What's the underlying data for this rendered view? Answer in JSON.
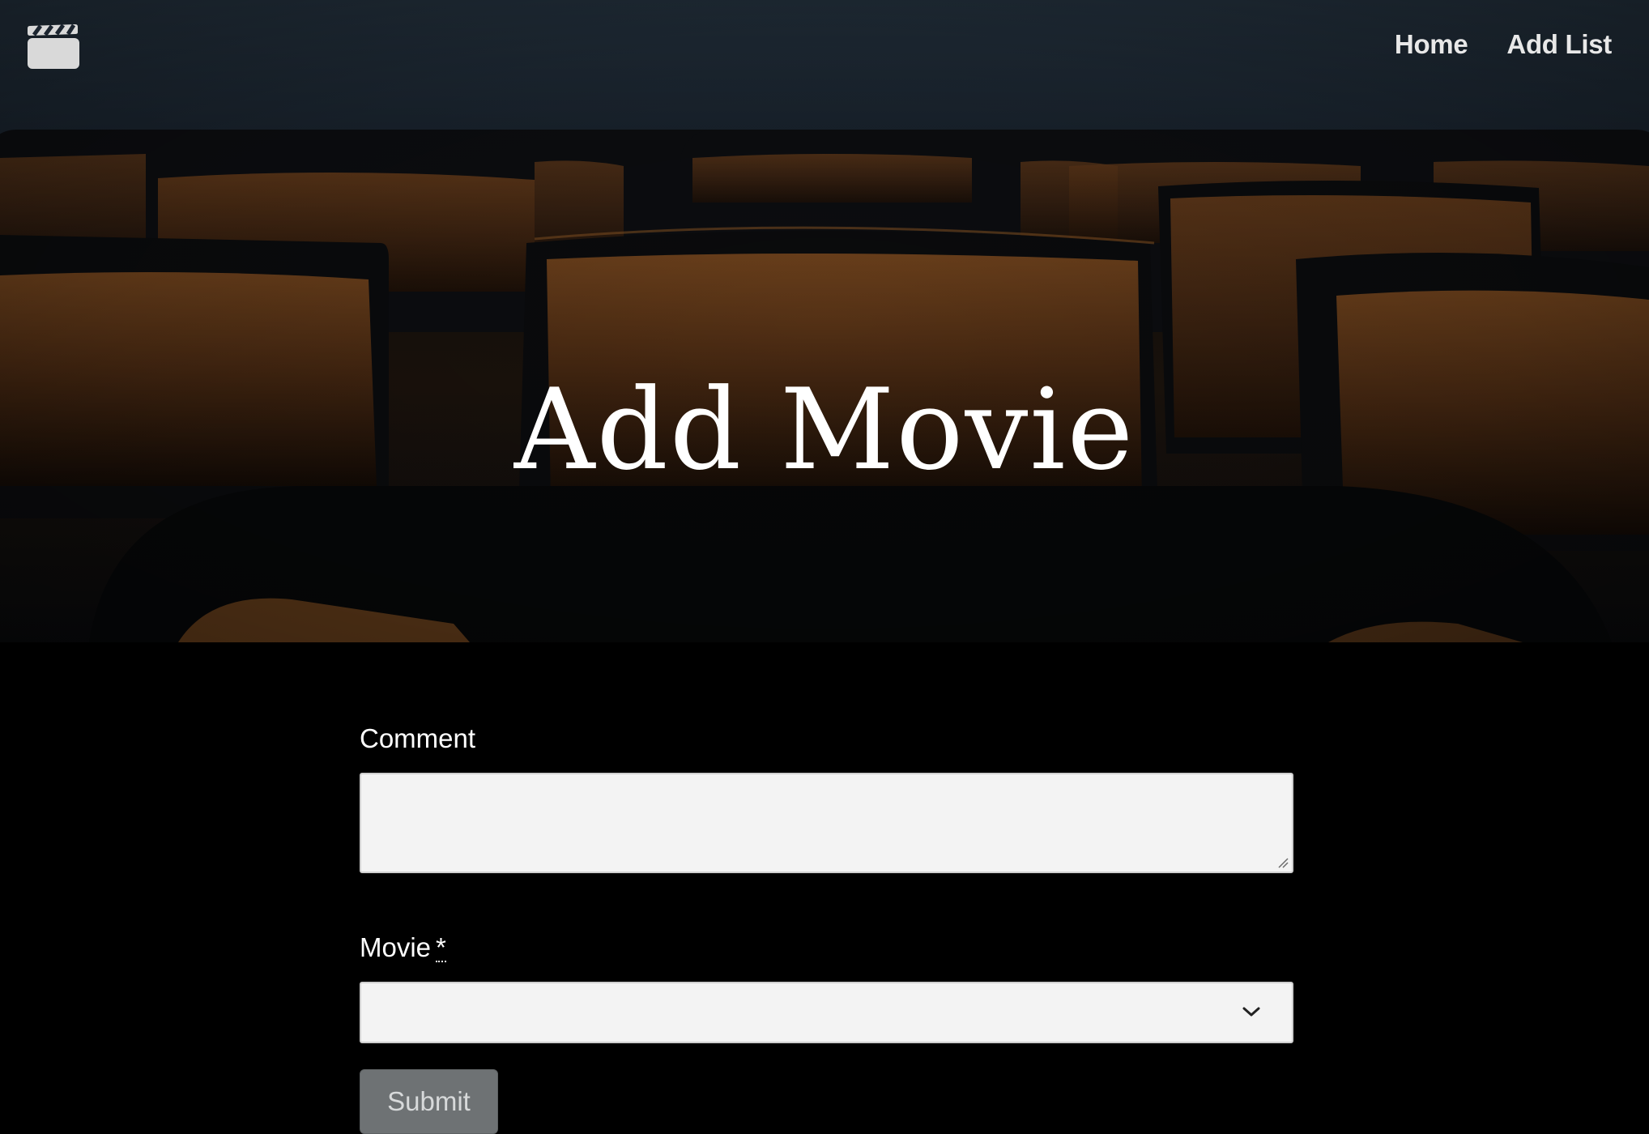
{
  "nav": {
    "logo_icon": "clapperboard-icon",
    "links": [
      "Home",
      "Add List"
    ]
  },
  "hero": {
    "title": "Add Movie"
  },
  "form": {
    "comment_label": "Comment",
    "comment_value": "",
    "movie_label": "Movie",
    "movie_required_mark": "*",
    "movie_selected": "",
    "submit_label": "Submit"
  },
  "colors": {
    "page_background": "#000000",
    "field_background": "#f3f3f3",
    "submit_background": "#6e7274",
    "title_color": "#ffffff"
  }
}
